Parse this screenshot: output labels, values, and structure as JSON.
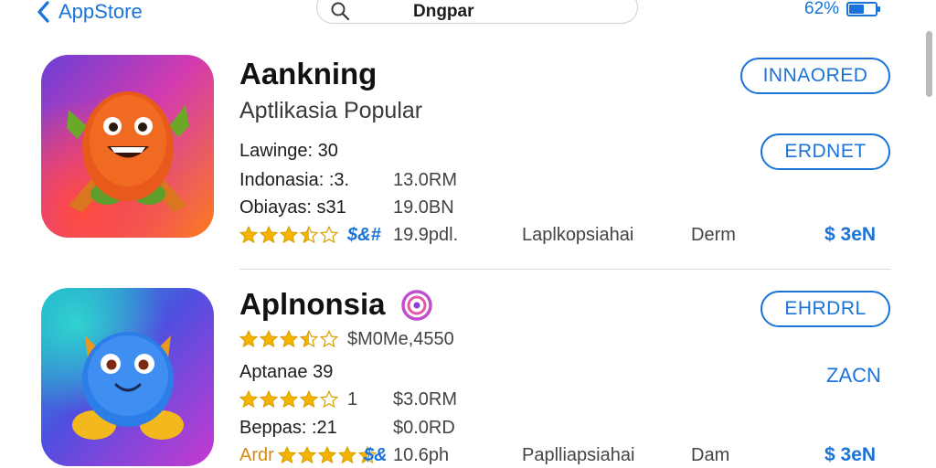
{
  "topbar": {
    "back_label": "AppStore",
    "search_query": "Dngpar",
    "battery_percent": "62%",
    "battery_level": 0.62
  },
  "apps": [
    {
      "title": "Aankning",
      "subtitle": "Aptlikasia Popular",
      "rows": [
        "Lawinge: 30",
        "Indonasia: :3.",
        "Obiayas: s31"
      ],
      "values": [
        "13.0RM",
        "19.0BN",
        "19.9pdl."
      ],
      "rating": 3.5,
      "rating_text": "$&#",
      "category": "Laplkopsiahai",
      "meta": "Derm",
      "buttons": [
        "INNAORED",
        "ERDNET"
      ],
      "price": "$ 3eN"
    },
    {
      "title": "Aplnonsia",
      "rating_line": "$M0Me,4550",
      "rating_top": 3.5,
      "rows": [
        "Aptanae 39",
        "",
        "Beppas: :21"
      ],
      "values": [
        "",
        "$3.0RM",
        "$0.0RD"
      ],
      "rating_mid": 4,
      "rating_mid_text": "1",
      "rating_bottom_prefix": "Ardr",
      "rating_bottom": 4.5,
      "rating_text": "$&",
      "extra_value": "10.6ph",
      "category": "Paplliapsiahai",
      "meta": "Dam",
      "buttons": [
        "EHRDRL",
        "ZACN"
      ],
      "price": "$ 3eN"
    }
  ]
}
